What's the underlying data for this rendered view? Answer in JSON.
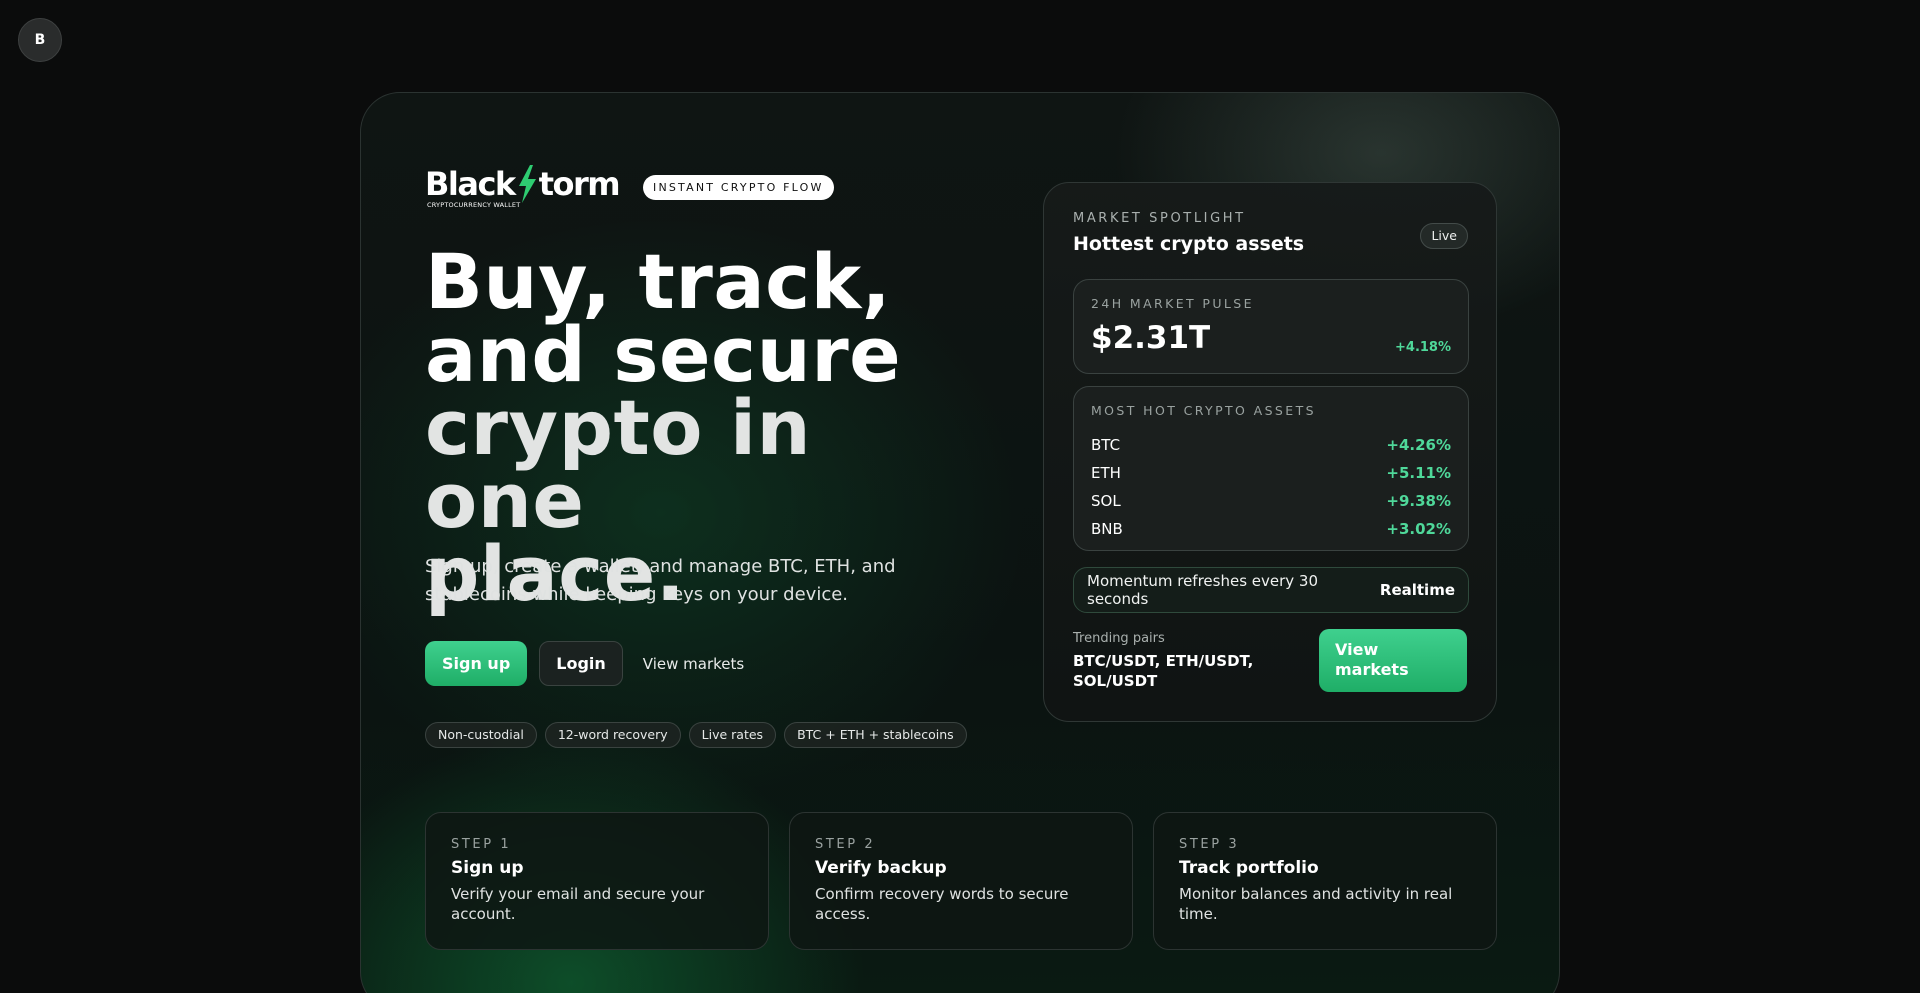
{
  "profile": {
    "avatar_initial": "B"
  },
  "brand": {
    "logo_text_left": "Black",
    "logo_text_right": "torm",
    "logo_subtitle": "CRYPTOCURRENCY WALLET",
    "tagline": "INSTANT CRYPTO FLOW",
    "accent_color": "#1fae67"
  },
  "hero": {
    "headline": [
      "Buy, track,",
      "and secure",
      "crypto in one",
      "place."
    ],
    "subtitle": "Sign up, create a wallet, and manage BTC, ETH, and stablecoins while keeping keys on your device.",
    "buttons": {
      "signup": "Sign up",
      "login": "Login",
      "view_markets": "View markets"
    },
    "chips": [
      "Non-custodial",
      "12-word recovery",
      "Live rates",
      "BTC + ETH + stablecoins"
    ]
  },
  "spotlight": {
    "eyebrow": "MARKET SPOTLIGHT",
    "title": "Hottest crypto assets",
    "badge": "Live",
    "pulse": {
      "label": "24H MARKET PULSE",
      "value": "$2.31T",
      "change": "+4.18%"
    },
    "hot_assets": {
      "label": "MOST HOT CRYPTO ASSETS",
      "items": [
        {
          "symbol": "BTC",
          "change": "+4.26%"
        },
        {
          "symbol": "ETH",
          "change": "+5.11%"
        },
        {
          "symbol": "SOL",
          "change": "+9.38%"
        },
        {
          "symbol": "BNB",
          "change": "+3.02%"
        }
      ]
    },
    "momentum": {
      "text": "Momentum refreshes every 30 seconds",
      "tag": "Realtime"
    },
    "trending": {
      "label": "Trending pairs",
      "value": "BTC/USDT, ETH/USDT, SOL/USDT"
    },
    "cta": "View markets"
  },
  "steps": [
    {
      "eyebrow": "STEP 1",
      "title": "Sign up",
      "desc": "Verify your email and secure your account."
    },
    {
      "eyebrow": "STEP 2",
      "title": "Verify backup",
      "desc": "Confirm recovery words to secure access."
    },
    {
      "eyebrow": "STEP 3",
      "title": "Track portfolio",
      "desc": "Monitor balances and activity in real time."
    }
  ]
}
